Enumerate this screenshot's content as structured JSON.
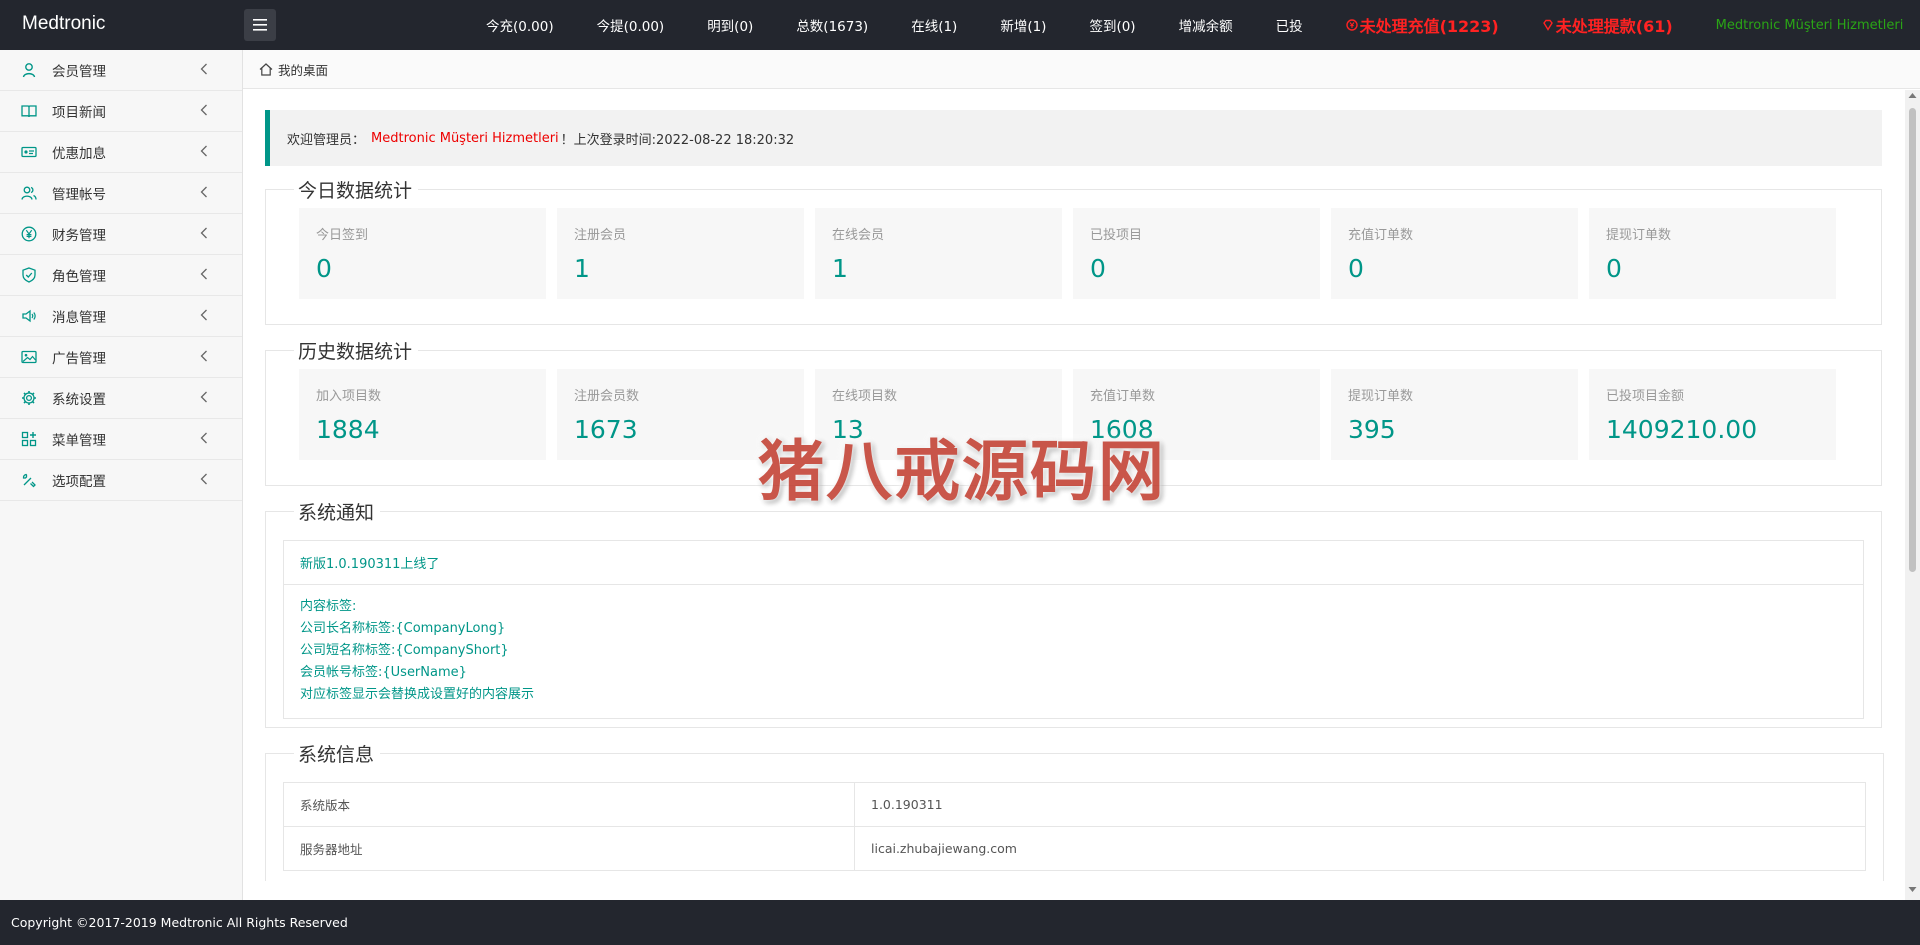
{
  "header": {
    "brand": "Medtronic",
    "nav": [
      "今充(0.00)",
      "今提(0.00)",
      "明到(0)",
      "总数(1673)",
      "在线(1)",
      "新增(1)",
      "签到(0)",
      "增减余额",
      "已投"
    ],
    "alert_recharge": "未处理充值(1223)",
    "alert_withdraw": "未处理提款(61)",
    "user": "Medtronic Müşteri Hizmetleri"
  },
  "sidebar": {
    "items": [
      {
        "label": "会员管理",
        "icon": "user-icon"
      },
      {
        "label": "项目新闻",
        "icon": "book-icon"
      },
      {
        "label": "优惠加息",
        "icon": "ticket-icon"
      },
      {
        "label": "管理帐号",
        "icon": "user-group-icon"
      },
      {
        "label": "财务管理",
        "icon": "yen-icon"
      },
      {
        "label": "角色管理",
        "icon": "shield-icon"
      },
      {
        "label": "消息管理",
        "icon": "speaker-icon"
      },
      {
        "label": "广告管理",
        "icon": "picture-icon"
      },
      {
        "label": "系统设置",
        "icon": "gear-icon"
      },
      {
        "label": "菜单管理",
        "icon": "grid-icon"
      },
      {
        "label": "选项配置",
        "icon": "tools-icon"
      }
    ]
  },
  "tab": {
    "label": "我的桌面"
  },
  "welcome": {
    "prefix": "欢迎管理员：",
    "name": "Medtronic Müşteri Hizmetleri",
    "suffix": "！上次登录时间:2022-08-22 18:20:32"
  },
  "today": {
    "title": "今日数据统计",
    "cards": [
      {
        "label": "今日签到",
        "value": "0"
      },
      {
        "label": "注册会员",
        "value": "1"
      },
      {
        "label": "在线会员",
        "value": "1"
      },
      {
        "label": "已投项目",
        "value": "0"
      },
      {
        "label": "充值订单数",
        "value": "0"
      },
      {
        "label": "提现订单数",
        "value": "0"
      }
    ]
  },
  "history": {
    "title": "历史数据统计",
    "cards": [
      {
        "label": "加入项目数",
        "value": "1884"
      },
      {
        "label": "注册会员数",
        "value": "1673"
      },
      {
        "label": "在线项目数",
        "value": "13"
      },
      {
        "label": "充值订单数",
        "value": "1608"
      },
      {
        "label": "提现订单数",
        "value": "395"
      },
      {
        "label": "已投项目金额",
        "value": "1409210.00"
      }
    ]
  },
  "notice": {
    "title": "系统通知",
    "headline": "新版1.0.190311上线了",
    "lines": [
      "内容标签:",
      "公司长名称标签:{CompanyLong}",
      "公司短名称标签:{CompanyShort}",
      "会员帐号标签:{UserName}",
      "对应标签显示会替换成设置好的内容展示"
    ]
  },
  "sysinfo": {
    "title": "系统信息",
    "rows": [
      {
        "key": "系统版本",
        "value": "1.0.190311"
      },
      {
        "key": "服务器地址",
        "value": "licai.zhubajiewang.com"
      }
    ]
  },
  "watermark": "猪八戒源码网",
  "footer": "Copyright ©2017-2019 Medtronic All Rights Reserved",
  "colors": {
    "header_bg": "#23262e",
    "accent": "#009688",
    "alert": "#ff2222",
    "user": "#2aa516"
  }
}
